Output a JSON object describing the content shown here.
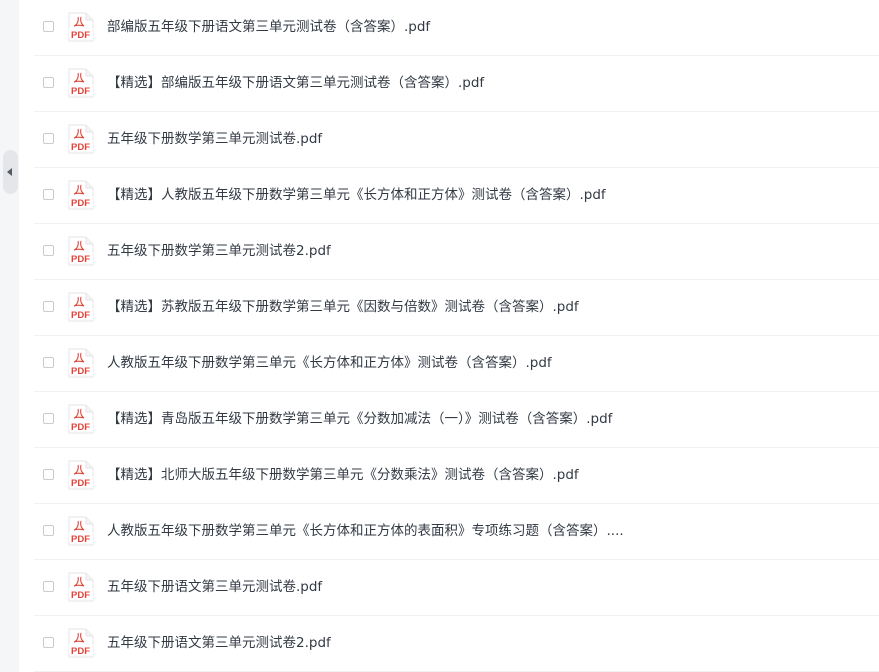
{
  "sidebar": {
    "collapse_icon": "caret-left-icon"
  },
  "file_icon": {
    "name": "pdf-icon",
    "label": "PDF",
    "color": "#e5443b"
  },
  "files": [
    {
      "name": "部编版五年级下册语文第三单元测试卷（含答案）.pdf"
    },
    {
      "name": "【精选】部编版五年级下册语文第三单元测试卷（含答案）.pdf"
    },
    {
      "name": "五年级下册数学第三单元测试卷.pdf"
    },
    {
      "name": "【精选】人教版五年级下册数学第三单元《长方体和正方体》测试卷（含答案）.pdf"
    },
    {
      "name": "五年级下册数学第三单元测试卷2.pdf"
    },
    {
      "name": "【精选】苏教版五年级下册数学第三单元《因数与倍数》测试卷（含答案）.pdf"
    },
    {
      "name": "人教版五年级下册数学第三单元《长方体和正方体》测试卷（含答案）.pdf"
    },
    {
      "name": "【精选】青岛版五年级下册数学第三单元《分数加减法（一）》测试卷（含答案）.pdf"
    },
    {
      "name": "【精选】北师大版五年级下册数学第三单元《分数乘法》测试卷（含答案）.pdf"
    },
    {
      "name": "人教版五年级下册数学第三单元《长方体和正方体的表面积》专项练习题（含答案）...."
    },
    {
      "name": "五年级下册语文第三单元测试卷.pdf"
    },
    {
      "name": "五年级下册语文第三单元测试卷2.pdf"
    }
  ]
}
